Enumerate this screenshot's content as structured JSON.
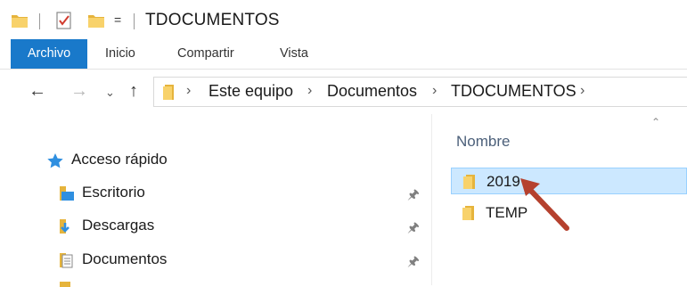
{
  "titlebar": {
    "title": "TDOCUMENTOS",
    "qat_dropdown": "="
  },
  "ribbon": {
    "tabs": [
      {
        "label": "Archivo",
        "active": true
      },
      {
        "label": "Inicio"
      },
      {
        "label": "Compartir"
      },
      {
        "label": "Vista"
      }
    ]
  },
  "navigation": {
    "back_icon": "arrow-left",
    "forward_icon": "arrow-right",
    "recent_icon": "chevron-down",
    "up_icon": "arrow-up",
    "breadcrumb": [
      "Este equipo",
      "Documentos",
      "TDOCUMENTOS"
    ]
  },
  "navpane": {
    "quick_access": "Acceso rápido",
    "items": [
      {
        "label": "Escritorio",
        "icon": "desktop-folder-icon",
        "pinned": true
      },
      {
        "label": "Descargas",
        "icon": "downloads-folder-icon",
        "pinned": true
      },
      {
        "label": "Documentos",
        "icon": "documents-folder-icon",
        "pinned": true
      }
    ]
  },
  "content": {
    "column_header": "Nombre",
    "files": [
      {
        "name": "2019",
        "type": "folder",
        "selected": true
      },
      {
        "name": "TEMP",
        "type": "folder",
        "selected": false
      }
    ]
  },
  "colors": {
    "accent": "#1979ca",
    "selection_bg": "#cce8ff",
    "selection_border": "#99d1ff",
    "folder": "#f4c550",
    "annotation_arrow": "#b5412e"
  }
}
